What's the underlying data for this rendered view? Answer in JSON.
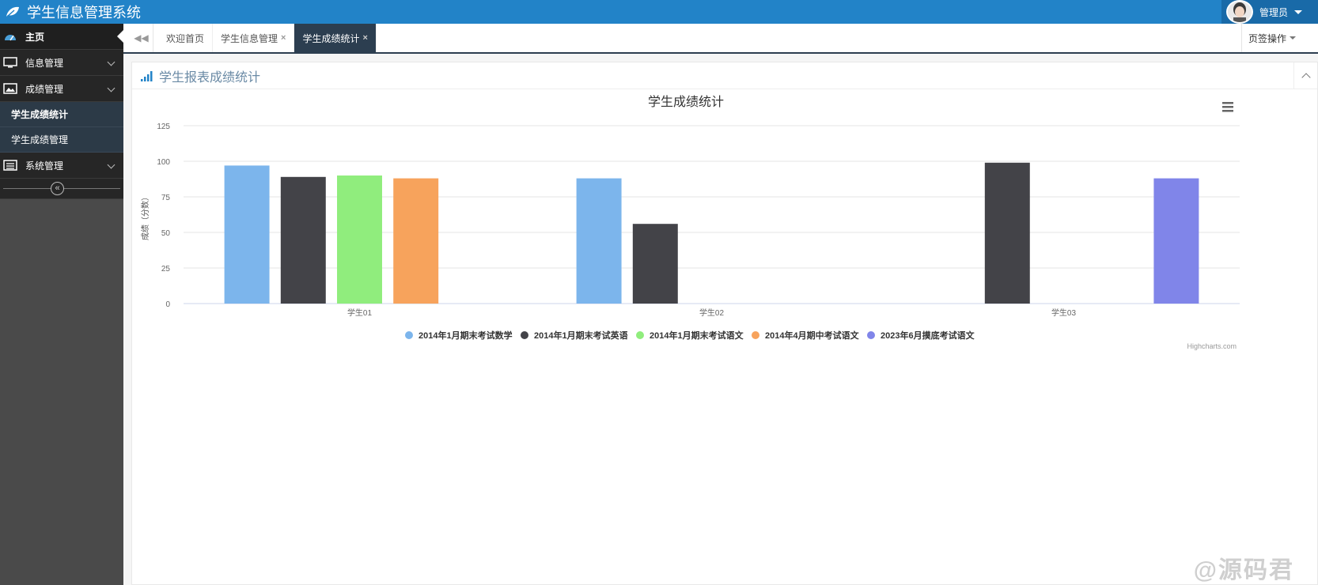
{
  "app": {
    "title": "学生信息管理系统",
    "user_name": "管理员"
  },
  "sidebar": {
    "home": "主页",
    "info": "信息管理",
    "score": "成绩管理",
    "score_stats": "学生成绩统计",
    "score_manage": "学生成绩管理",
    "system": "系统管理",
    "collapse_icon": "«"
  },
  "tabs": {
    "back_icon": "◀◀",
    "items": [
      {
        "label": "欢迎首页",
        "closable": false
      },
      {
        "label": "学生信息管理",
        "closable": true,
        "close": "×"
      },
      {
        "label": "学生成绩统计",
        "closable": true,
        "close": "×"
      }
    ],
    "ops_label": "页签操作"
  },
  "panel": {
    "title": "学生报表成绩统计"
  },
  "colors": {
    "topbar": "#2283c8",
    "tab_active": "#2c3e50",
    "series": [
      "#7cb5ec",
      "#434348",
      "#90ed7d",
      "#f7a35c",
      "#8085e9"
    ]
  },
  "chart_data": {
    "type": "bar",
    "title": "学生成绩统计",
    "ylabel": "成绩（分数）",
    "xlabel": "",
    "ylim": [
      0,
      125
    ],
    "yticks": [
      0,
      25,
      50,
      75,
      100,
      125
    ],
    "categories": [
      "学生01",
      "学生02",
      "学生03"
    ],
    "series": [
      {
        "name": "2014年1月期末考试数学",
        "values": [
          97,
          88,
          null
        ]
      },
      {
        "name": "2014年1月期末考试英语",
        "values": [
          89,
          56,
          99
        ]
      },
      {
        "name": "2014年1月期末考试语文",
        "values": [
          90,
          null,
          null
        ]
      },
      {
        "name": "2014年4月期中考试语文",
        "values": [
          88,
          null,
          null
        ]
      },
      {
        "name": "2023年6月摸底考试语文",
        "values": [
          null,
          null,
          88
        ]
      }
    ],
    "grid": true,
    "legend": "bottom",
    "credits": "Highcharts.com"
  },
  "watermark": "@源码君"
}
